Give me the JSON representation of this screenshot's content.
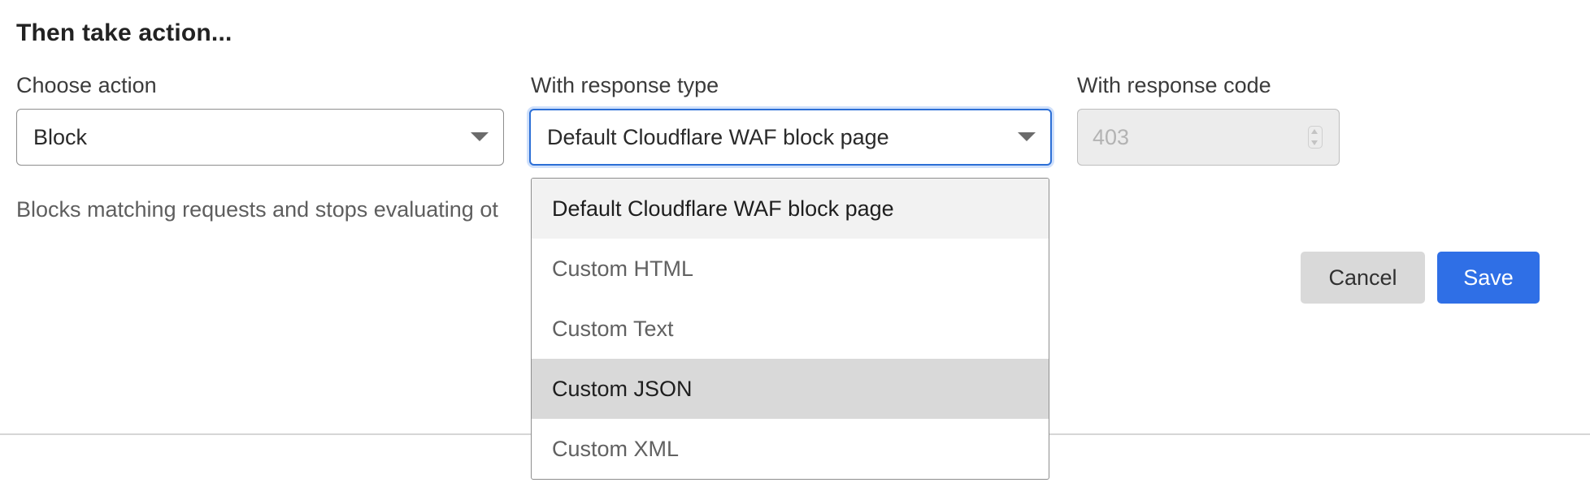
{
  "section": {
    "heading": "Then take action..."
  },
  "action": {
    "label": "Choose action",
    "value": "Block"
  },
  "response_type": {
    "label": "With response type",
    "value": "Default Cloudflare WAF block page",
    "options": [
      "Default Cloudflare WAF block page",
      "Custom HTML",
      "Custom Text",
      "Custom JSON",
      "Custom XML"
    ],
    "selected_index": 0,
    "hovered_index": 3
  },
  "response_code": {
    "label": "With response code",
    "value": "403",
    "disabled": true
  },
  "helper": {
    "text": "Blocks matching requests and stops evaluating ot"
  },
  "buttons": {
    "cancel": "Cancel",
    "save": "Save"
  },
  "colors": {
    "accent": "#2f6fe6",
    "focus_ring": "#2c6fd6",
    "option_hover": "#d9d9d9",
    "option_selected": "#f2f2f2"
  }
}
